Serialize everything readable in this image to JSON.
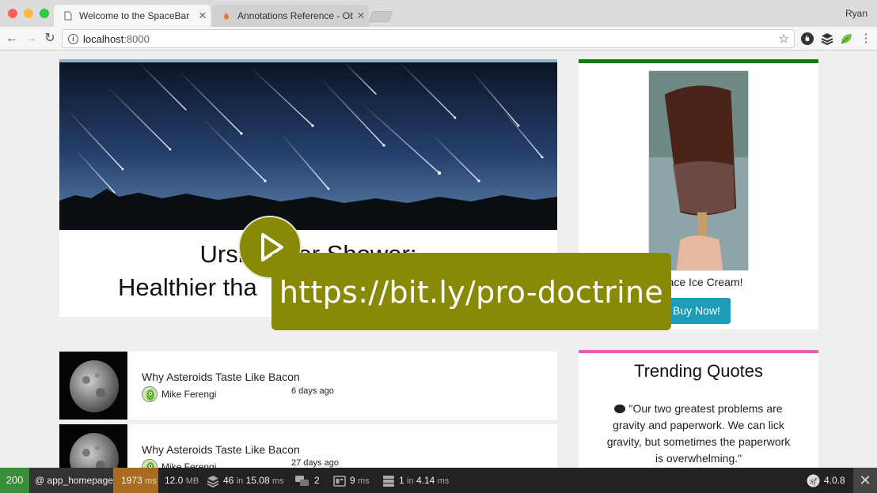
{
  "browser": {
    "tabs": [
      {
        "title": "Welcome to the SpaceBar",
        "active": true
      },
      {
        "title": "Annotations Reference - Objec",
        "active": false
      }
    ],
    "profile_name": "Ryan",
    "address": {
      "host": "localhost",
      "port": ":8000"
    }
  },
  "page": {
    "hero_headline_line1": "Ursid      er Shower:",
    "hero_headline_line2": "Healthier tha",
    "ad": {
      "text": "Space Ice Cream!",
      "button": "Buy Now!"
    },
    "articles": [
      {
        "title": "Why Asteroids Taste Like Bacon",
        "author": "Mike Ferengi",
        "time": "6 days ago"
      },
      {
        "title": "Why Asteroids Taste Like Bacon",
        "author": "Mike Ferengi",
        "time": "27 days ago"
      }
    ],
    "quotes": {
      "title": "Trending Quotes",
      "text": "\"Our two greatest problems are gravity and paperwork. We can lick gravity, but sometimes the paperwork is overwhelming.\""
    }
  },
  "overlay": {
    "link": "https://bit.ly/pro-doctrine"
  },
  "debugbar": {
    "status": "200",
    "route": "@ app_homepage",
    "time_value": "1973",
    "time_unit": "ms",
    "memory_value": "12.0",
    "memory_unit": "MB",
    "db_queries": "46",
    "db_in": "in",
    "db_time": "15.08",
    "db_time_unit": "ms",
    "translations": "2",
    "twig_time": "9",
    "twig_unit": "ms",
    "cache_count": "1",
    "cache_in": "in",
    "cache_time": "4.14",
    "cache_unit": "ms",
    "symfony_version": "4.0.8",
    "colors": {
      "status_ok": "#3a8b3a",
      "time_warn": "#a86d20"
    }
  }
}
